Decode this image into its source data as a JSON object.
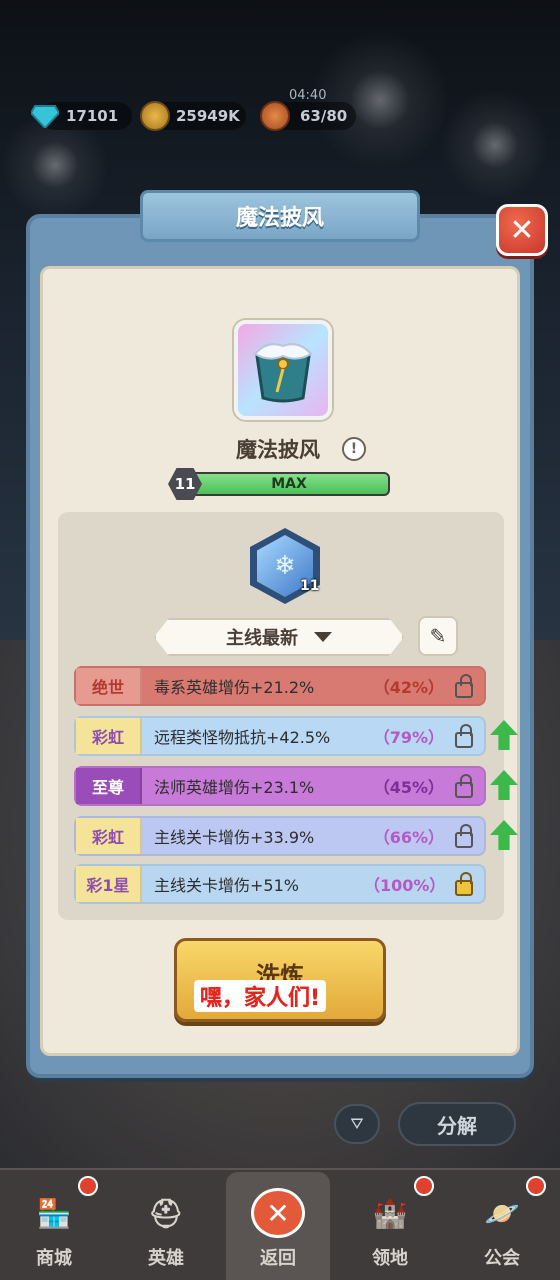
{
  "top_bar": {
    "gems": "17101",
    "gold": "25949K",
    "energy_timer": "04:40",
    "energy": "63/80"
  },
  "dialog": {
    "title": "魔法披风",
    "close_icon": "close-icon"
  },
  "item": {
    "name": "魔法披风",
    "level": "11",
    "level_bar_text": "MAX",
    "level_progress": 1.0
  },
  "rune": {
    "level": "11"
  },
  "preset": {
    "label": "主线最新"
  },
  "attributes": [
    {
      "tag": "绝世",
      "text": "毒系英雄增伤+21.2%",
      "pct": "（42%）",
      "color": "#d97a72",
      "tag_color": "#b33a2e",
      "upgrade": false
    },
    {
      "tag": "彩虹",
      "text": "远程类怪物抵抗+42.5%",
      "pct": "（79%）",
      "color": "#b8d8f4",
      "tag_color": "#8c4fb0",
      "upgrade": true
    },
    {
      "tag": "至尊",
      "text": "法师英雄增伤+23.1%",
      "pct": "（45%）",
      "color": "#c87ad8",
      "tag_color": "#ffffff",
      "upgrade": true
    },
    {
      "tag": "彩虹",
      "text": "主线关卡增伤+33.9%",
      "pct": "（66%）",
      "color": "#bcc8f2",
      "tag_color": "#8c4fb0",
      "upgrade": true
    },
    {
      "tag": "彩1星",
      "text": "主线关卡增伤+51%",
      "pct": "（100%）",
      "color": "#b8d6f0",
      "tag_color": "#8c4fb0",
      "upgrade": false
    }
  ],
  "refine_button": {
    "label": "洗炼",
    "caption": "嘿，家人们!"
  },
  "controls": {
    "decompose": "分解"
  },
  "nav": [
    {
      "label": "商城",
      "icon": "shop-icon",
      "badge": true
    },
    {
      "label": "英雄",
      "icon": "hero-helmet-icon",
      "badge": false
    },
    {
      "label": "返回",
      "icon": "return-icon",
      "badge": false
    },
    {
      "label": "领地",
      "icon": "castle-icon",
      "badge": true
    },
    {
      "label": "公会",
      "icon": "planet-icon",
      "badge": true
    }
  ]
}
